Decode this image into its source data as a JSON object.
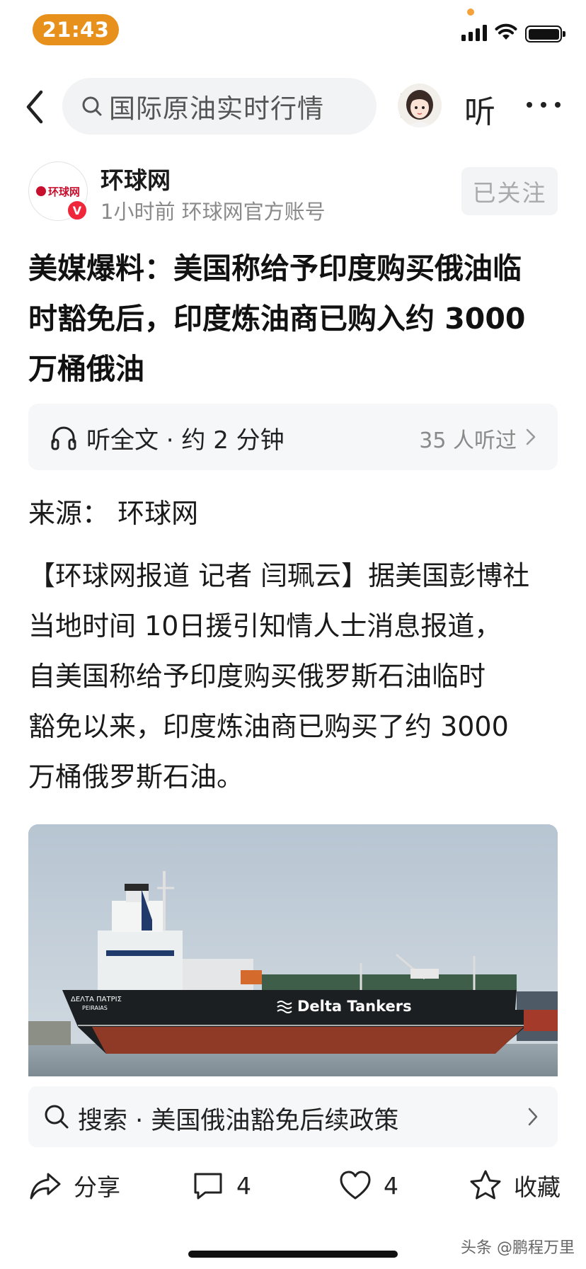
{
  "status_bar": {
    "time": "21:43"
  },
  "nav": {
    "search_text": "国际原油实时行情",
    "listen_label": "听"
  },
  "author": {
    "logo_text": "环球网",
    "name": "环球网",
    "meta": "1小时前  环球网官方账号",
    "verified_badge": "V",
    "follow_label": "已关注"
  },
  "article": {
    "title_lines": [
      "美媒爆料：美国称给予印度购买俄油临",
      "时豁免后，印度炼油商已购入约 3000",
      "万桶俄油"
    ],
    "listen_card": {
      "label": "听全文 · 约 2 分钟",
      "count": "35 人听过"
    },
    "source": "来源：  环球网",
    "body_lines": [
      "【环球网报道 记者 闫珮云】据美国彭博社",
      "当地时间 10日援引知情人士消息报道，",
      "自美国称给予印度购买俄罗斯石油临时",
      "豁免以来，印度炼油商已购买了约 3000",
      "万桶俄罗斯石油。"
    ],
    "image": {
      "ship_name": "ΔΕΛΤΑ ΠΑΤΡΙΣ",
      "port": "PEIRAIAS",
      "brand": "Delta Tankers"
    }
  },
  "related_search": "搜索 · 美国俄油豁免后续政策",
  "actions": {
    "share": "分享",
    "comment_count": "4",
    "like_count": "4",
    "favorite": "收藏"
  },
  "watermark": "头条 @鹏程万里",
  "colors": {
    "time_pill": "#e8901c",
    "verified": "#f0263a",
    "brand_red": "#c8102e",
    "card_bg": "#f6f7f8"
  },
  "icons": [
    "back-icon",
    "search-icon",
    "headphone-icon",
    "chevron-right-icon",
    "share-icon",
    "comment-icon",
    "heart-icon",
    "star-icon"
  ]
}
